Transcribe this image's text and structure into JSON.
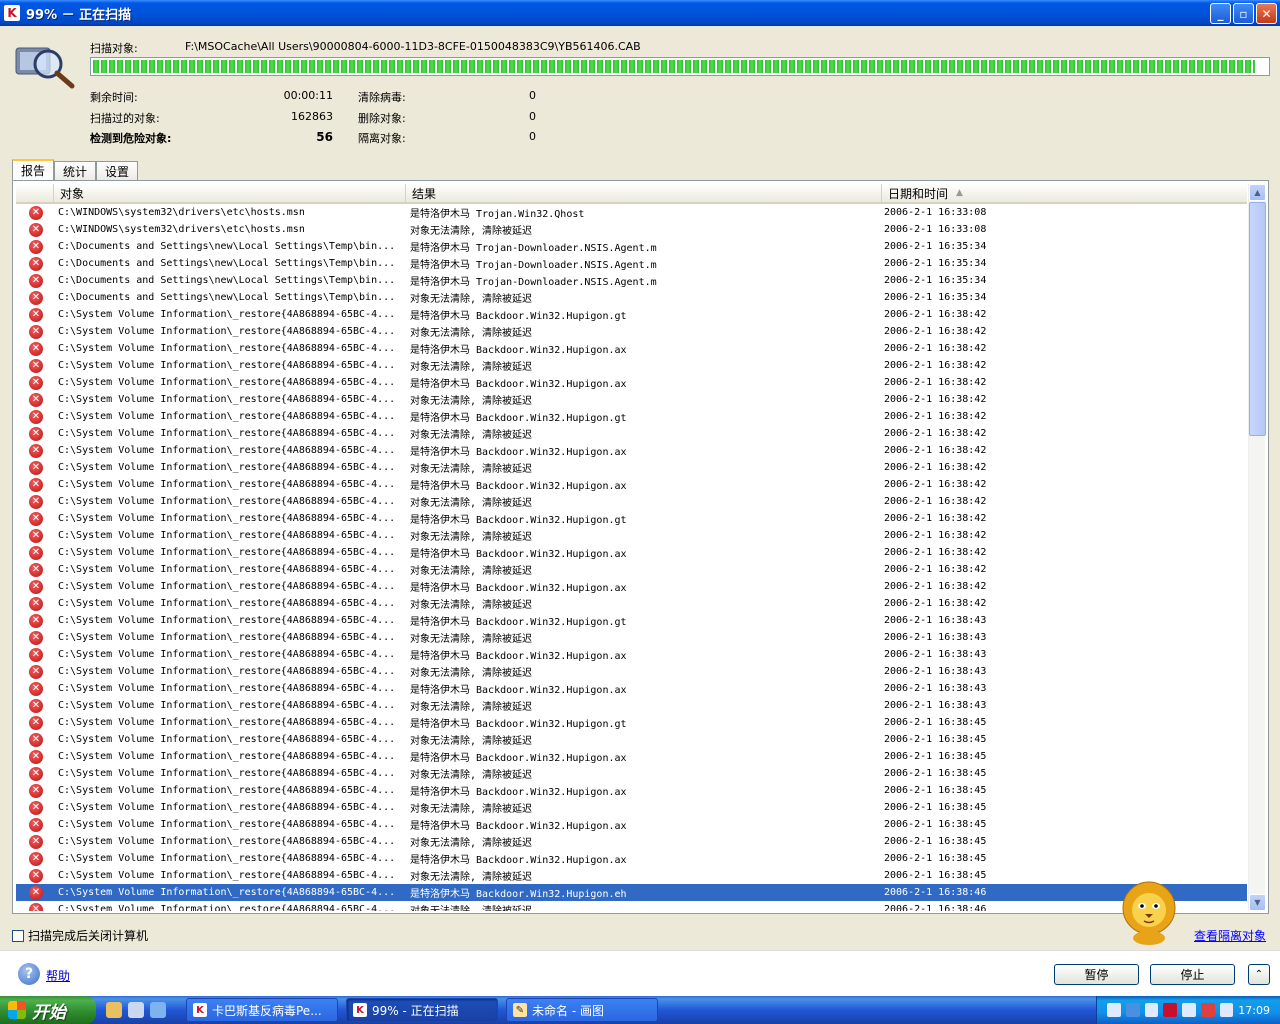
{
  "window": {
    "title": "99% － 正在扫描"
  },
  "header": {
    "scan_target_label": "扫描对象:",
    "scan_target_path": "F:\\MSOCache\\All Users\\90000804-6000-11D3-8CFE-0150048383C9\\YB561406.CAB",
    "progress_percent": 99,
    "stats": {
      "time_left_label": "剩余时间:",
      "time_left_value": "00:00:11",
      "scanned_label": "扫描过的对象:",
      "scanned_value": "162863",
      "detected_label": "检测到危险对象:",
      "detected_value": "56",
      "cleaned_label": "清除病毒:",
      "cleaned_value": "0",
      "deleted_label": "删除对象:",
      "deleted_value": "0",
      "quarantined_label": "隔离对象:",
      "quarantined_value": "0"
    }
  },
  "tabs": [
    {
      "label": "报告"
    },
    {
      "label": "统计"
    },
    {
      "label": "设置"
    }
  ],
  "table": {
    "columns": {
      "object": "对象",
      "result": "结果",
      "datetime": "日期和时间"
    },
    "rows": [
      {
        "object": "C:\\WINDOWS\\system32\\drivers\\etc\\hosts.msn",
        "result": "是特洛伊木马 Trojan.Win32.Qhost",
        "datetime": "2006-2-1 16:33:08"
      },
      {
        "object": "C:\\WINDOWS\\system32\\drivers\\etc\\hosts.msn",
        "result": "对象无法清除, 清除被延迟",
        "datetime": "2006-2-1 16:33:08"
      },
      {
        "object": "C:\\Documents and Settings\\new\\Local Settings\\Temp\\bin...",
        "result": "是特洛伊木马 Trojan-Downloader.NSIS.Agent.m",
        "datetime": "2006-2-1 16:35:34"
      },
      {
        "object": "C:\\Documents and Settings\\new\\Local Settings\\Temp\\bin...",
        "result": "是特洛伊木马 Trojan-Downloader.NSIS.Agent.m",
        "datetime": "2006-2-1 16:35:34"
      },
      {
        "object": "C:\\Documents and Settings\\new\\Local Settings\\Temp\\bin...",
        "result": "是特洛伊木马 Trojan-Downloader.NSIS.Agent.m",
        "datetime": "2006-2-1 16:35:34"
      },
      {
        "object": "C:\\Documents and Settings\\new\\Local Settings\\Temp\\bin...",
        "result": "对象无法清除, 清除被延迟",
        "datetime": "2006-2-1 16:35:34"
      },
      {
        "object": "C:\\System Volume Information\\_restore{4A868894-65BC-4...",
        "result": "是特洛伊木马 Backdoor.Win32.Hupigon.gt",
        "datetime": "2006-2-1 16:38:42"
      },
      {
        "object": "C:\\System Volume Information\\_restore{4A868894-65BC-4...",
        "result": "对象无法清除, 清除被延迟",
        "datetime": "2006-2-1 16:38:42"
      },
      {
        "object": "C:\\System Volume Information\\_restore{4A868894-65BC-4...",
        "result": "是特洛伊木马 Backdoor.Win32.Hupigon.ax",
        "datetime": "2006-2-1 16:38:42"
      },
      {
        "object": "C:\\System Volume Information\\_restore{4A868894-65BC-4...",
        "result": "对象无法清除, 清除被延迟",
        "datetime": "2006-2-1 16:38:42"
      },
      {
        "object": "C:\\System Volume Information\\_restore{4A868894-65BC-4...",
        "result": "是特洛伊木马 Backdoor.Win32.Hupigon.ax",
        "datetime": "2006-2-1 16:38:42"
      },
      {
        "object": "C:\\System Volume Information\\_restore{4A868894-65BC-4...",
        "result": "对象无法清除, 清除被延迟",
        "datetime": "2006-2-1 16:38:42"
      },
      {
        "object": "C:\\System Volume Information\\_restore{4A868894-65BC-4...",
        "result": "是特洛伊木马 Backdoor.Win32.Hupigon.gt",
        "datetime": "2006-2-1 16:38:42"
      },
      {
        "object": "C:\\System Volume Information\\_restore{4A868894-65BC-4...",
        "result": "对象无法清除, 清除被延迟",
        "datetime": "2006-2-1 16:38:42"
      },
      {
        "object": "C:\\System Volume Information\\_restore{4A868894-65BC-4...",
        "result": "是特洛伊木马 Backdoor.Win32.Hupigon.ax",
        "datetime": "2006-2-1 16:38:42"
      },
      {
        "object": "C:\\System Volume Information\\_restore{4A868894-65BC-4...",
        "result": "对象无法清除, 清除被延迟",
        "datetime": "2006-2-1 16:38:42"
      },
      {
        "object": "C:\\System Volume Information\\_restore{4A868894-65BC-4...",
        "result": "是特洛伊木马 Backdoor.Win32.Hupigon.ax",
        "datetime": "2006-2-1 16:38:42"
      },
      {
        "object": "C:\\System Volume Information\\_restore{4A868894-65BC-4...",
        "result": "对象无法清除, 清除被延迟",
        "datetime": "2006-2-1 16:38:42"
      },
      {
        "object": "C:\\System Volume Information\\_restore{4A868894-65BC-4...",
        "result": "是特洛伊木马 Backdoor.Win32.Hupigon.gt",
        "datetime": "2006-2-1 16:38:42"
      },
      {
        "object": "C:\\System Volume Information\\_restore{4A868894-65BC-4...",
        "result": "对象无法清除, 清除被延迟",
        "datetime": "2006-2-1 16:38:42"
      },
      {
        "object": "C:\\System Volume Information\\_restore{4A868894-65BC-4...",
        "result": "是特洛伊木马 Backdoor.Win32.Hupigon.ax",
        "datetime": "2006-2-1 16:38:42"
      },
      {
        "object": "C:\\System Volume Information\\_restore{4A868894-65BC-4...",
        "result": "对象无法清除, 清除被延迟",
        "datetime": "2006-2-1 16:38:42"
      },
      {
        "object": "C:\\System Volume Information\\_restore{4A868894-65BC-4...",
        "result": "是特洛伊木马 Backdoor.Win32.Hupigon.ax",
        "datetime": "2006-2-1 16:38:42"
      },
      {
        "object": "C:\\System Volume Information\\_restore{4A868894-65BC-4...",
        "result": "对象无法清除, 清除被延迟",
        "datetime": "2006-2-1 16:38:42"
      },
      {
        "object": "C:\\System Volume Information\\_restore{4A868894-65BC-4...",
        "result": "是特洛伊木马 Backdoor.Win32.Hupigon.gt",
        "datetime": "2006-2-1 16:38:43"
      },
      {
        "object": "C:\\System Volume Information\\_restore{4A868894-65BC-4...",
        "result": "对象无法清除, 清除被延迟",
        "datetime": "2006-2-1 16:38:43"
      },
      {
        "object": "C:\\System Volume Information\\_restore{4A868894-65BC-4...",
        "result": "是特洛伊木马 Backdoor.Win32.Hupigon.ax",
        "datetime": "2006-2-1 16:38:43"
      },
      {
        "object": "C:\\System Volume Information\\_restore{4A868894-65BC-4...",
        "result": "对象无法清除, 清除被延迟",
        "datetime": "2006-2-1 16:38:43"
      },
      {
        "object": "C:\\System Volume Information\\_restore{4A868894-65BC-4...",
        "result": "是特洛伊木马 Backdoor.Win32.Hupigon.ax",
        "datetime": "2006-2-1 16:38:43"
      },
      {
        "object": "C:\\System Volume Information\\_restore{4A868894-65BC-4...",
        "result": "对象无法清除, 清除被延迟",
        "datetime": "2006-2-1 16:38:43"
      },
      {
        "object": "C:\\System Volume Information\\_restore{4A868894-65BC-4...",
        "result": "是特洛伊木马 Backdoor.Win32.Hupigon.gt",
        "datetime": "2006-2-1 16:38:45"
      },
      {
        "object": "C:\\System Volume Information\\_restore{4A868894-65BC-4...",
        "result": "对象无法清除, 清除被延迟",
        "datetime": "2006-2-1 16:38:45"
      },
      {
        "object": "C:\\System Volume Information\\_restore{4A868894-65BC-4...",
        "result": "是特洛伊木马 Backdoor.Win32.Hupigon.ax",
        "datetime": "2006-2-1 16:38:45"
      },
      {
        "object": "C:\\System Volume Information\\_restore{4A868894-65BC-4...",
        "result": "对象无法清除, 清除被延迟",
        "datetime": "2006-2-1 16:38:45"
      },
      {
        "object": "C:\\System Volume Information\\_restore{4A868894-65BC-4...",
        "result": "是特洛伊木马 Backdoor.Win32.Hupigon.ax",
        "datetime": "2006-2-1 16:38:45"
      },
      {
        "object": "C:\\System Volume Information\\_restore{4A868894-65BC-4...",
        "result": "对象无法清除, 清除被延迟",
        "datetime": "2006-2-1 16:38:45"
      },
      {
        "object": "C:\\System Volume Information\\_restore{4A868894-65BC-4...",
        "result": "是特洛伊木马 Backdoor.Win32.Hupigon.ax",
        "datetime": "2006-2-1 16:38:45"
      },
      {
        "object": "C:\\System Volume Information\\_restore{4A868894-65BC-4...",
        "result": "对象无法清除, 清除被延迟",
        "datetime": "2006-2-1 16:38:45"
      },
      {
        "object": "C:\\System Volume Information\\_restore{4A868894-65BC-4...",
        "result": "是特洛伊木马 Backdoor.Win32.Hupigon.ax",
        "datetime": "2006-2-1 16:38:45"
      },
      {
        "object": "C:\\System Volume Information\\_restore{4A868894-65BC-4...",
        "result": "对象无法清除, 清除被延迟",
        "datetime": "2006-2-1 16:38:45"
      },
      {
        "object": "C:\\System Volume Information\\_restore{4A868894-65BC-4...",
        "result": "是特洛伊木马 Backdoor.Win32.Hupigon.eh",
        "datetime": "2006-2-1 16:38:46",
        "selected": true
      },
      {
        "object": "C:\\System Volume Information\\_restore{4A868894-65BC-4...",
        "result": "对象无法清除, 清除被延迟",
        "datetime": "2006-2-1 16:38:46"
      }
    ]
  },
  "bottom": {
    "shutdown_checkbox_label": "扫描完成后关闭计算机",
    "shutdown_checked": false,
    "view_quarantine_link": "查看隔离对象"
  },
  "footer": {
    "help_label": "帮助",
    "pause_label": "暂停",
    "stop_label": "停止",
    "collapse_glyph": "⌃"
  },
  "taskbar": {
    "start_label": "开始",
    "tasks": [
      {
        "label": "卡巴斯基反病毒Pe..."
      },
      {
        "label": "99% - 正在扫描"
      },
      {
        "label": "未命名 - 画图"
      }
    ],
    "clock": "17:09"
  }
}
